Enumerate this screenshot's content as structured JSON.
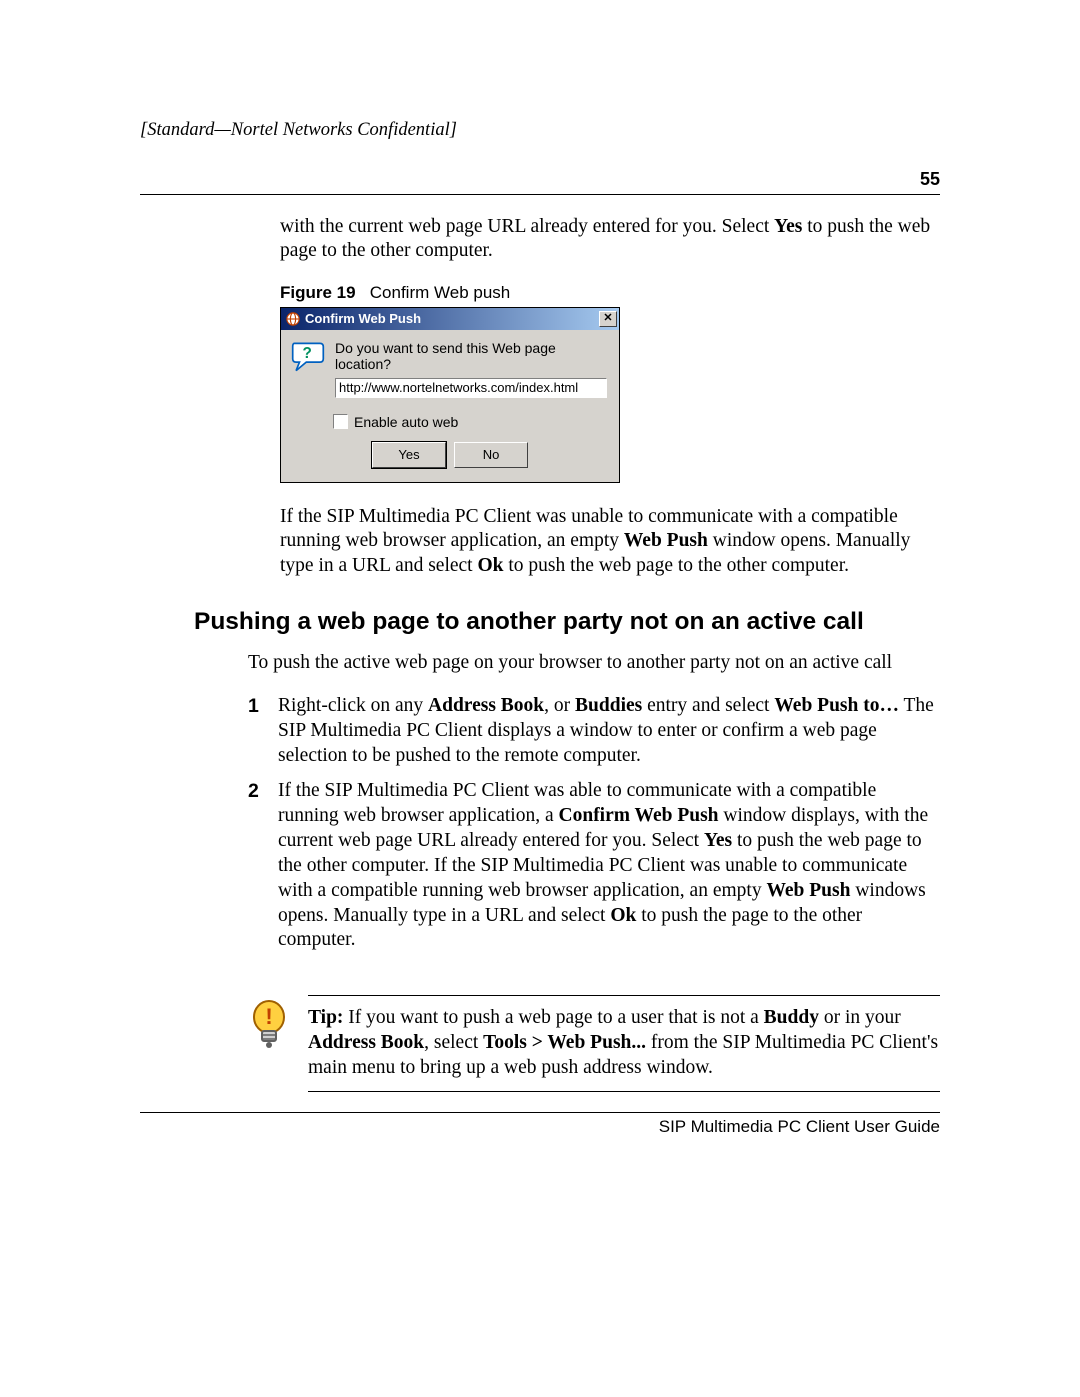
{
  "header": {
    "confidential": "[Standard—Nortel Networks Confidential]",
    "page_number": "55"
  },
  "continuation_text_pre": "with the current web page URL already entered for you. Select ",
  "continuation_bold1": "Yes",
  "continuation_text_post": " to push the web page to the other computer.",
  "figure": {
    "label": "Figure 19",
    "caption": "Confirm Web push"
  },
  "dialog": {
    "title": "Confirm Web Push",
    "prompt": "Do you want to send this Web page location?",
    "url_value": "http://www.nortelnetworks.com/index.html",
    "checkbox_label": "Enable auto web",
    "yes_label": "Yes",
    "no_label": "No",
    "close_glyph": "✕"
  },
  "after_figure": {
    "t1": "If the SIP Multimedia PC Client was unable to communicate with a compatible running web browser application, an empty ",
    "b1": "Web Push",
    "t2": " window opens. Manually type in a URL and select ",
    "b2": "Ok",
    "t3": " to push the web page to the other computer."
  },
  "section_heading": "Pushing a web page to another party not on an active call",
  "intro_line": "To push the active web page on your browser to another party not on an active call",
  "steps": {
    "s1": {
      "num": "1",
      "t1": "Right-click on any ",
      "b1": "Address Book",
      "t2": ", or ",
      "b2": "Buddies",
      "t3": " entry and select ",
      "b3": "Web Push to…",
      "t4": " The SIP Multimedia PC Client displays a window to enter or confirm a web page selection to be pushed to the remote computer."
    },
    "s2": {
      "num": "2",
      "t1": "If the SIP Multimedia PC Client was able to communicate with a compatible running web browser application, a ",
      "b1": "Confirm Web Push",
      "t2": " window displays, with the current web page URL already entered for you. Select ",
      "b2": "Yes",
      "t3": " to push the web page to the other computer. If the SIP Multimedia PC Client was unable to communicate with a compatible running web browser application, an empty ",
      "b3": "Web Push",
      "t4": " windows opens. Manually type in a URL and select ",
      "b4": "Ok",
      "t5": " to push the page to the other computer."
    }
  },
  "tip": {
    "label": "Tip:",
    "t1": " If you want to push a web page to a user that is not a ",
    "b1": "Buddy",
    "t2": " or in your ",
    "b2": "Address Book",
    "t3": ", select ",
    "b3": "Tools > Web Push...",
    "t4": " from the SIP Multimedia PC Client's main menu to bring up a web push address window."
  },
  "footer": "SIP Multimedia PC Client User Guide"
}
